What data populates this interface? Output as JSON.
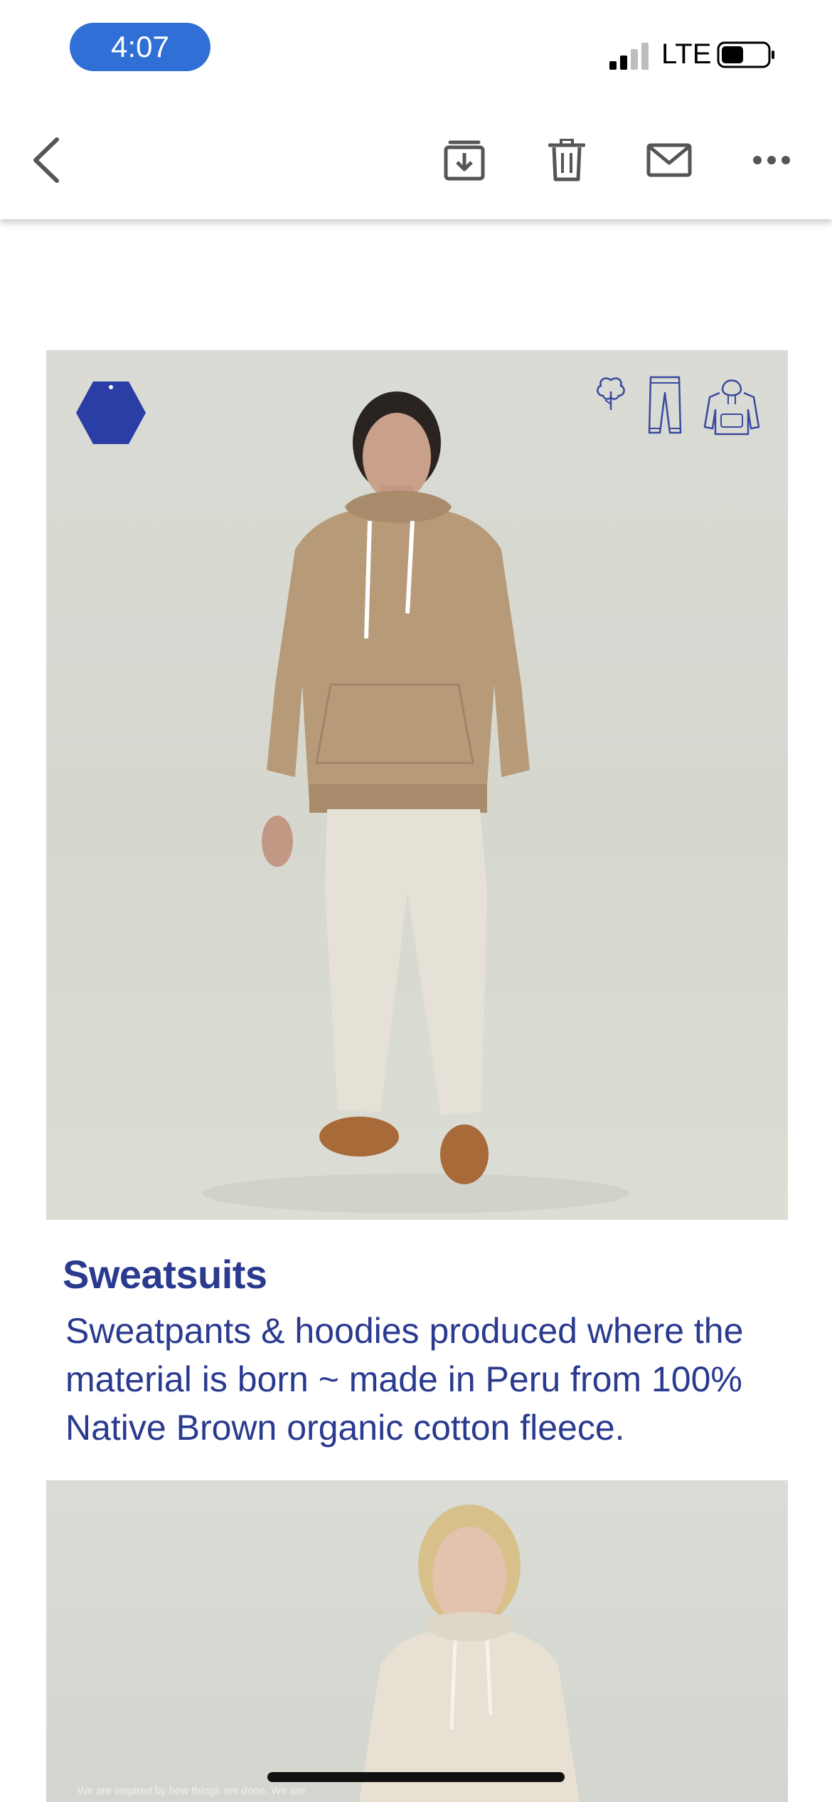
{
  "status_bar": {
    "time": "4:07",
    "carrier": "LTE",
    "signal_bars_active": 2,
    "signal_bars_total": 4,
    "battery_level": 0.45
  },
  "toolbar": {
    "back_icon": "chevron-left-icon",
    "archive_icon": "archive-icon",
    "delete_icon": "trash-icon",
    "mail_icon": "envelope-icon",
    "more_icon": "more-horizontal-icon"
  },
  "email": {
    "hero_icons": [
      "hexagon-logo-icon",
      "cotton-plant-icon",
      "sweatpants-icon",
      "hoodie-icon"
    ],
    "section": {
      "title": "Sweatsuits",
      "description": "Sweatpants & hoodies produced where the material is born ~ made in Peru from 100% Native Brown organic cotton fleece."
    },
    "second_image_caption": "We are inspired by how things are done. We are"
  },
  "colors": {
    "brand_blue": "#2a3a8f",
    "time_pill": "#2f6fd6",
    "icon_gray": "#555555"
  }
}
